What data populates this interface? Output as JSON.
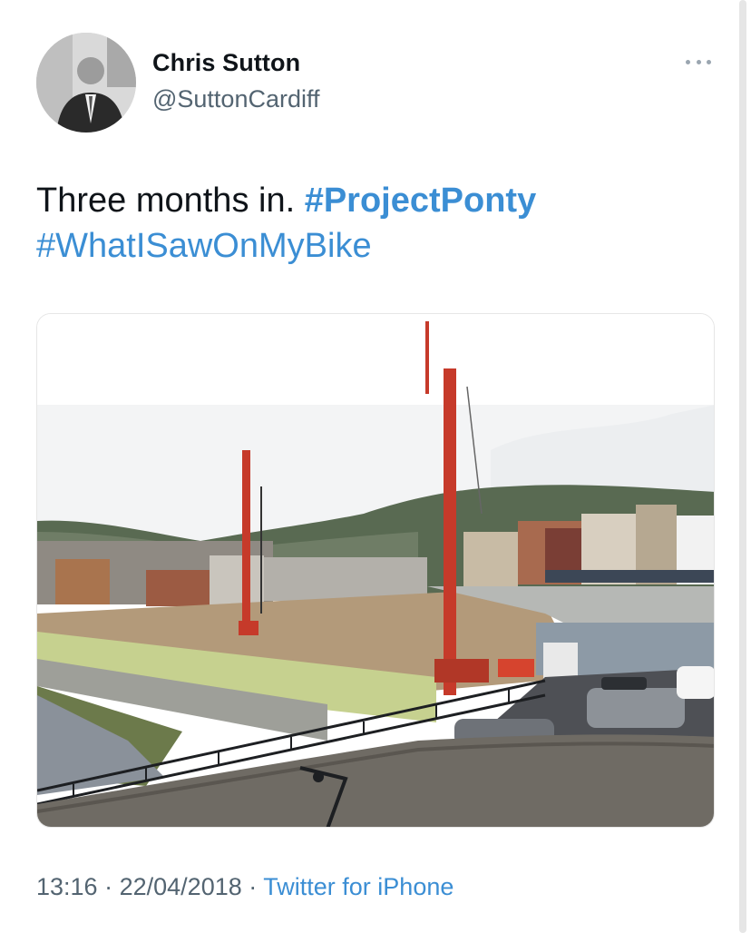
{
  "author": {
    "name": "Chris Sutton",
    "handle": "@SuttonCardiff"
  },
  "tweet": {
    "text_plain": "Three months in. ",
    "hashtags": [
      "#ProjectPonty",
      "#WhatISawOnMyBike"
    ]
  },
  "meta": {
    "time": "13:16",
    "separator": "·",
    "date": "22/04/2018",
    "source": "Twitter for iPhone"
  },
  "icons": {
    "more": "more-options-icon"
  },
  "colors": {
    "link": "#3b8ed4",
    "text": "#0f1419",
    "secondary": "#536471"
  }
}
